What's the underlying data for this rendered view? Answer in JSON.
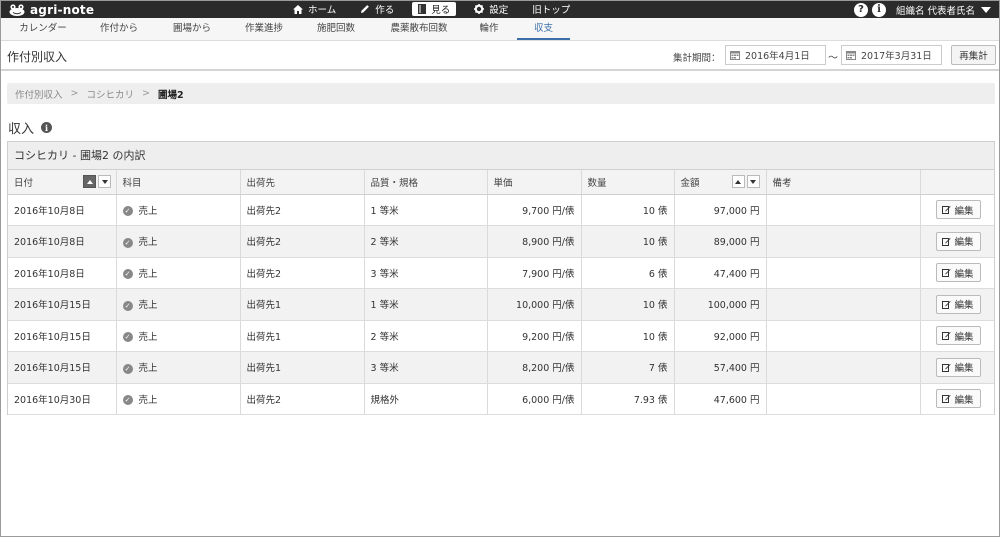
{
  "app": {
    "logo_text": "agri-note"
  },
  "topnav": [
    {
      "label": "ホーム",
      "icon": "home-icon"
    },
    {
      "label": "作る",
      "icon": "pencil-icon"
    },
    {
      "label": "見る",
      "icon": "book-icon",
      "active": true
    },
    {
      "label": "設定",
      "icon": "gear-icon"
    },
    {
      "label": "旧トップ",
      "icon": ""
    }
  ],
  "topright": {
    "help": "?",
    "info": "i",
    "user": "組織名 代表者氏名"
  },
  "subtabs": [
    "カレンダー",
    "作付から",
    "圃場から",
    "作業進捗",
    "施肥回数",
    "農薬散布回数",
    "輪作",
    "収支"
  ],
  "page": {
    "title": "作付別収入",
    "period_label": "集計期間：",
    "date_from": "2016年4月1日",
    "date_to": "2017年3月31日",
    "tilde": "〜",
    "recalc_label": "再集計"
  },
  "breadcrumb": {
    "items": [
      "作付別収入",
      "コシヒカリ"
    ],
    "current": "圃場2",
    "separator": ">"
  },
  "section": {
    "title": "収入",
    "info": "i"
  },
  "panel": {
    "title": "コシヒカリ - 圃場2 の内訳",
    "columns": [
      "日付",
      "科目",
      "出荷先",
      "品質・規格",
      "単価",
      "数量",
      "金額",
      "備考",
      ""
    ],
    "edit_label": "編集",
    "rows": [
      {
        "date": "2016年10月8日",
        "item": "売上",
        "dest": "出荷先2",
        "grade": "1 等米",
        "price": "9,700 円/俵",
        "qty": "10 俵",
        "amount": "97,000 円",
        "note": ""
      },
      {
        "date": "2016年10月8日",
        "item": "売上",
        "dest": "出荷先2",
        "grade": "2 等米",
        "price": "8,900 円/俵",
        "qty": "10 俵",
        "amount": "89,000 円",
        "note": ""
      },
      {
        "date": "2016年10月8日",
        "item": "売上",
        "dest": "出荷先2",
        "grade": "3 等米",
        "price": "7,900 円/俵",
        "qty": "6 俵",
        "amount": "47,400 円",
        "note": ""
      },
      {
        "date": "2016年10月15日",
        "item": "売上",
        "dest": "出荷先1",
        "grade": "1 等米",
        "price": "10,000 円/俵",
        "qty": "10 俵",
        "amount": "100,000 円",
        "note": ""
      },
      {
        "date": "2016年10月15日",
        "item": "売上",
        "dest": "出荷先1",
        "grade": "2 等米",
        "price": "9,200 円/俵",
        "qty": "10 俵",
        "amount": "92,000 円",
        "note": ""
      },
      {
        "date": "2016年10月15日",
        "item": "売上",
        "dest": "出荷先1",
        "grade": "3 等米",
        "price": "8,200 円/俵",
        "qty": "7 俵",
        "amount": "57,400 円",
        "note": ""
      },
      {
        "date": "2016年10月30日",
        "item": "売上",
        "dest": "出荷先2",
        "grade": "規格外",
        "price": "6,000 円/俵",
        "qty": "7.93 俵",
        "amount": "47,600 円",
        "note": ""
      }
    ]
  },
  "colors": {
    "topbar": "#2b2b2b",
    "accent": "#3a6fa8"
  }
}
